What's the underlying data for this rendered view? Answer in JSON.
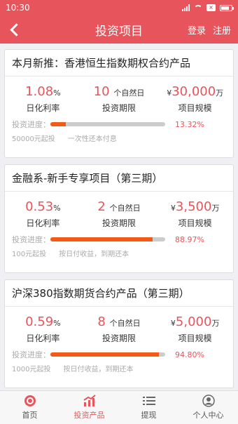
{
  "status_bar": {
    "time": "10:30"
  },
  "nav": {
    "title": "投资项目",
    "login": "登录",
    "register": "注册"
  },
  "products": [
    {
      "title": "本月新推：香港恒生指数期权合约产品",
      "rate": "1.08",
      "rate_unit": "%",
      "rate_label": "日化利率",
      "term": "10",
      "term_unit": "个自然日",
      "term_label": "投资期限",
      "scale_prefix": "¥",
      "scale": "30,000",
      "scale_unit": "万",
      "scale_label": "项目规模",
      "progress_label": "投资进度：",
      "progress_text": "13.32%",
      "progress": 0.1332,
      "note_min": "50000元起投",
      "note_repay": "一次性还本付息"
    },
    {
      "title": "金融系-新手专享项目（第三期）",
      "rate": "0.53",
      "rate_unit": "%",
      "rate_label": "日化利率",
      "term": "2",
      "term_unit": "个自然日",
      "term_label": "投资期限",
      "scale_prefix": "¥",
      "scale": "3,500",
      "scale_unit": "万",
      "scale_label": "项目规模",
      "progress_label": "投资进度：",
      "progress_text": "88.97%",
      "progress": 0.8897,
      "note_min": "100元起投",
      "note_repay": "按日付收益，到期还本"
    },
    {
      "title": "沪深380指数期货合约产品（第三期）",
      "rate": "0.59",
      "rate_unit": "%",
      "rate_label": "日化利率",
      "term": "8",
      "term_unit": "个自然日",
      "term_label": "投资期限",
      "scale_prefix": "¥",
      "scale": "5,000",
      "scale_unit": "万",
      "scale_label": "项目规模",
      "progress_label": "投资进度：",
      "progress_text": "94.80%",
      "progress": 0.948,
      "note_min": "1000元起投",
      "note_repay": "按日付收益，到期还本"
    }
  ],
  "tabs": [
    {
      "label": "首页",
      "icon": "home-icon"
    },
    {
      "label": "投资产品",
      "icon": "chart-icon"
    },
    {
      "label": "提现",
      "icon": "list-icon"
    },
    {
      "label": "个人中心",
      "icon": "user-icon"
    }
  ],
  "colors": {
    "brand": "#e8545b",
    "progress": "#f25a16"
  }
}
